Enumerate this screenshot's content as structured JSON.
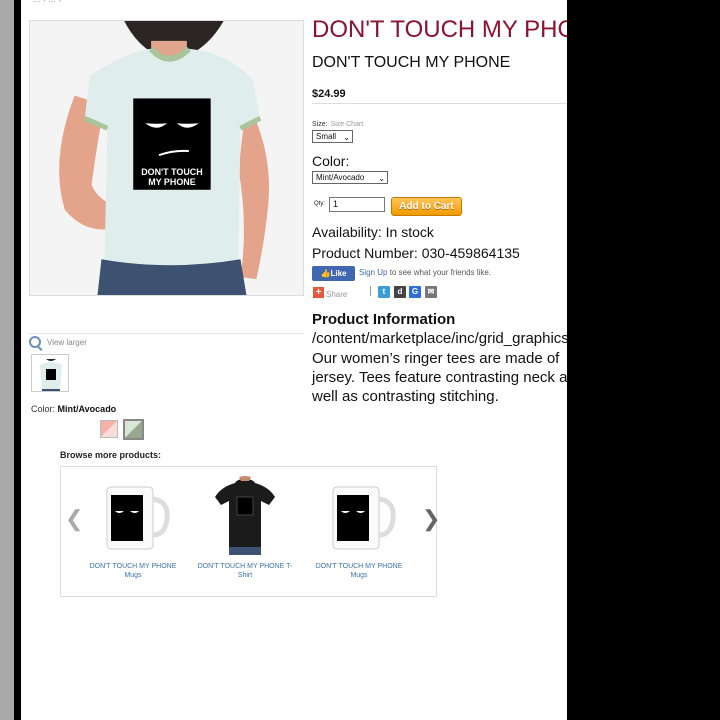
{
  "breadcrumb": "... › ... ›",
  "product": {
    "title": "DON'T TOUCH MY PHONE T-Shirt",
    "subtitle": "DON'T TOUCH MY PHONE",
    "price": "$24.99",
    "size_label": "Size:",
    "size_chart_link": "Size Chart",
    "size_value": "Small",
    "color_label": "Color:",
    "color_value": "Mint/Avocado",
    "qty_label": "Qty:",
    "qty_value": "1",
    "add_to_cart": "Add to Cart",
    "availability": "Availability: In stock",
    "product_number": "Product Number: 030-459864135",
    "shirt_print_line1": "DON'T TOUCH",
    "shirt_print_line2": "MY PHONE"
  },
  "social": {
    "like_label": "Like",
    "signup_link": "Sign Up",
    "signup_text": " to see what your friends like.",
    "share_label": "Share",
    "icons": [
      "twitter-icon",
      "digg-icon",
      "google-icon",
      "email-icon"
    ]
  },
  "gallery": {
    "view_larger": "View larger",
    "color_prefix": "Color: ",
    "color_name": "Mint/Avocado",
    "swatches": [
      {
        "name": "Pink",
        "color": "#f5b0aa"
      },
      {
        "name": "Mint/Avocado",
        "color": "#97a88f"
      }
    ]
  },
  "browse": {
    "title": "Browse more products:",
    "items": [
      {
        "caption": "DON'T TOUCH MY PHONE Mugs"
      },
      {
        "caption": "DON'T TOUCH MY PHONE T-Shirt"
      },
      {
        "caption": "DON'T TOUCH MY PHONE Mugs"
      }
    ]
  },
  "info": {
    "title": "Product Information",
    "path": "/content/marketplace/inc/grid_graphics",
    "description": "Our women’s ringer tees are made of jersey. Tees feature contrasting neck as well as contrasting stitching."
  },
  "colors": {
    "title": "#8b1230",
    "link": "#3b74a8",
    "cart_button": "#f19a00",
    "facebook": "#4267b2"
  }
}
